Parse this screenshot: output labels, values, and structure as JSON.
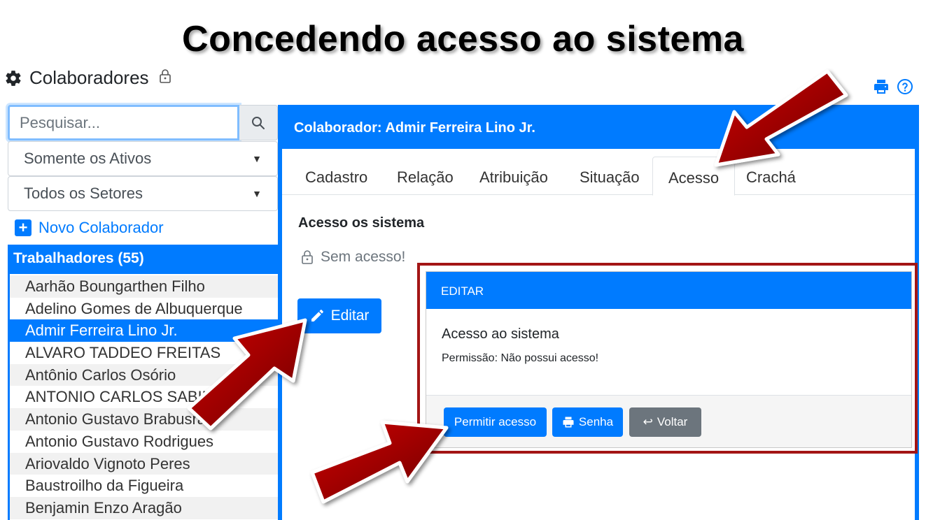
{
  "slide_title": "Concedendo acesso ao sistema",
  "app": {
    "title": "Colaboradores"
  },
  "search": {
    "placeholder": "Pesquisar..."
  },
  "filters": {
    "status": "Somente os Ativos",
    "sector": "Todos os Setores"
  },
  "new_collaborator": "Novo Colaborador",
  "list": {
    "header": "Trabalhadores (55)",
    "items": [
      "Aarhão Boungarthen Filho",
      "Adelino Gomes de Albuquerque",
      "Admir Ferreira Lino Jr.",
      "ALVARO TADDEO FREITAS",
      "Antônio Carlos Osório",
      "ANTONIO CARLOS SABINO",
      "Antonio Gustavo Brabusrad",
      "Antonio Gustavo Rodrigues",
      "Ariovaldo Vignoto Peres",
      "Baustroilho da Figueira",
      "Benjamin Enzo Aragão"
    ],
    "selected_index": 2
  },
  "main": {
    "header": "Colaborador: Admir Ferreira Lino Jr.",
    "tabs": [
      "Cadastro",
      "Relação",
      "Atribuição",
      "Situação",
      "Acesso",
      "Crachá"
    ],
    "active_tab": "Acesso",
    "section_title": "Acesso os sistema",
    "status": "Sem acesso!",
    "edit_button": "Editar"
  },
  "modal": {
    "header": "EDITAR",
    "title": "Acesso ao sistema",
    "text": "Permissão: Não possui acesso!",
    "buttons": {
      "allow": "Permitir acesso",
      "password": "Senha",
      "back": "Voltar"
    }
  },
  "colors": {
    "primary": "#007bff",
    "secondary": "#6c757d",
    "highlight": "#a31515",
    "arrow": "#b30000"
  }
}
